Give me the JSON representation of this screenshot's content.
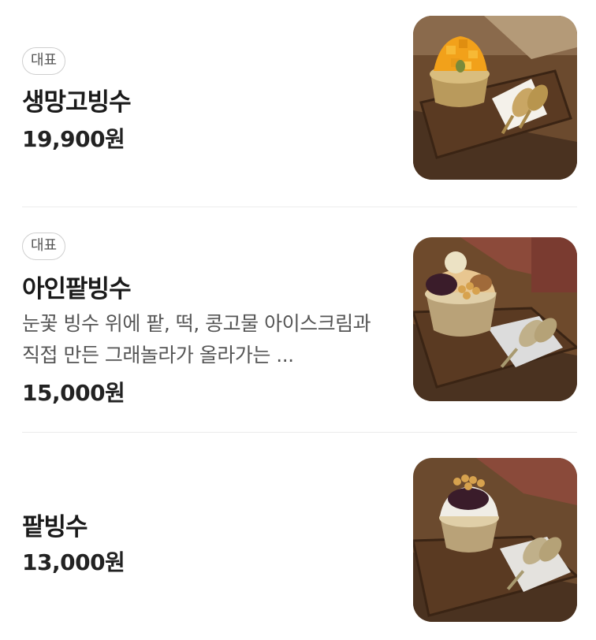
{
  "menu": {
    "items": [
      {
        "badge": "대표",
        "name": "생망고빙수",
        "description": "",
        "price": "19,900원",
        "image_icon": "mango-bingsu-photo"
      },
      {
        "badge": "대표",
        "name": "아인팥빙수",
        "description": "눈꽃 빙수 위에 팥, 떡, 콩고물 아이스크림과 직접 만든 그래놀라가 올라가는 ...",
        "price": "15,000원",
        "image_icon": "red-bean-bingsu-photo"
      },
      {
        "badge": "",
        "name": "팥빙수",
        "description": "",
        "price": "13,000원",
        "image_icon": "patbingsu-photo"
      }
    ]
  },
  "colors": {
    "text": "#1a1a1a",
    "secondary_text": "#555555",
    "badge_border": "#cfcfcf",
    "divider": "#ececec"
  }
}
